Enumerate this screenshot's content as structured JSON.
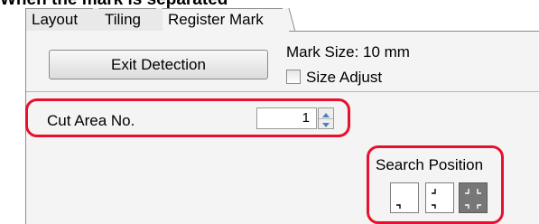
{
  "heading": "When the mark is separated",
  "tabs": [
    {
      "label": "Layout",
      "active": false
    },
    {
      "label": "Tiling",
      "active": false
    },
    {
      "label": "Register Mark",
      "active": true
    }
  ],
  "exit_button": {
    "label": "Exit Detection"
  },
  "mark_size": {
    "text": "Mark Size:  10 mm"
  },
  "size_adjust": {
    "label": "Size Adjust",
    "checked": false
  },
  "cut_area": {
    "label": "Cut Area No.",
    "value": "1"
  },
  "search_position": {
    "label": "Search Position",
    "options": [
      {
        "icon": "corner-1-mark-icon",
        "selected": false
      },
      {
        "icon": "corner-2-marks-icon",
        "selected": false
      },
      {
        "icon": "corner-4-marks-icon",
        "selected": true
      }
    ]
  },
  "colors": {
    "highlight": "#e8112d",
    "panel": "#f4f4f4",
    "selected_button": "#777777"
  }
}
